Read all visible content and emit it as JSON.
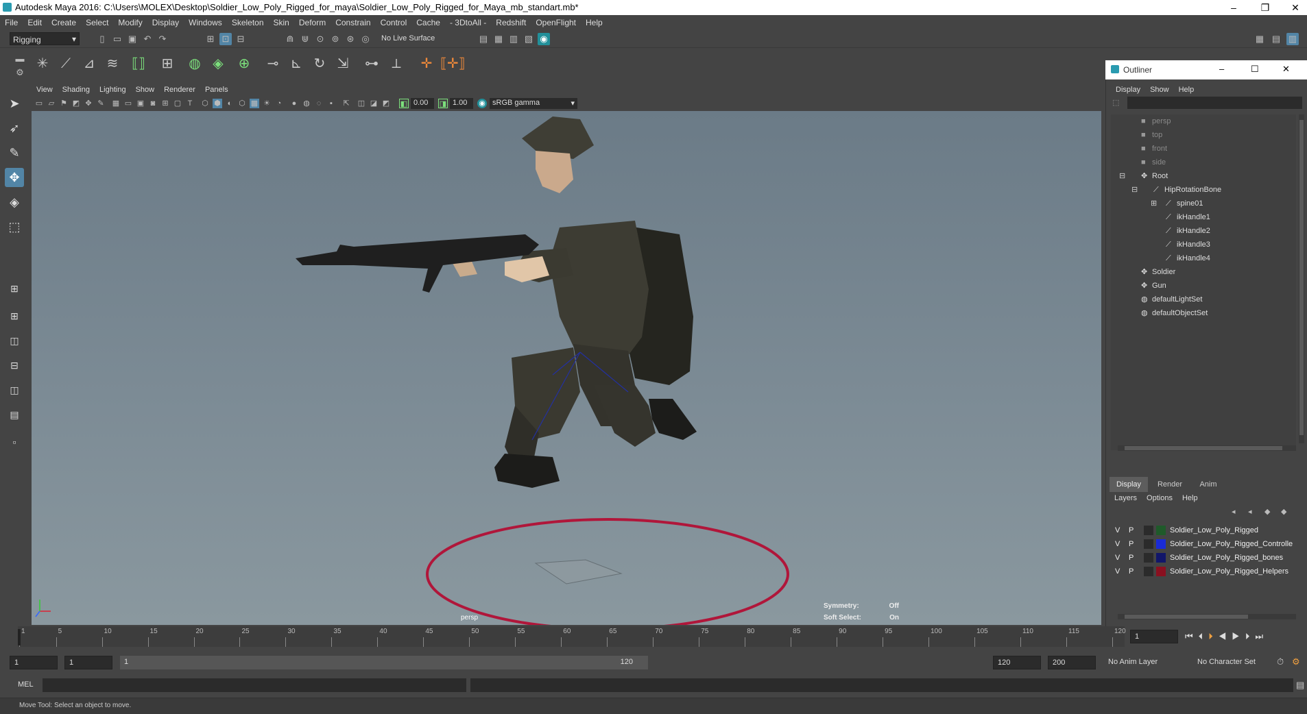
{
  "window": {
    "title": "Autodesk Maya 2016: C:\\Users\\MOLEX\\Desktop\\Soldier_Low_Poly_Rigged_for_maya\\Soldier_Low_Poly_Rigged_for_Maya_mb_standart.mb*",
    "controls": [
      "–",
      "❐",
      "✕"
    ]
  },
  "menubar": [
    "File",
    "Edit",
    "Create",
    "Select",
    "Modify",
    "Display",
    "Windows",
    "Skeleton",
    "Skin",
    "Deform",
    "Constrain",
    "Control",
    "Cache",
    "- 3DtoAll -",
    "Redshift",
    "OpenFlight",
    "Help"
  ],
  "toolbar": {
    "mode": "Rigging",
    "live_surface": "No Live Surface"
  },
  "viewport": {
    "menu": [
      "View",
      "Shading",
      "Lighting",
      "Show",
      "Renderer",
      "Panels"
    ],
    "near_value": "0.00",
    "far_value": "1.00",
    "color_space": "sRGB gamma",
    "camera_label": "persp",
    "hud": [
      {
        "label": "Symmetry:",
        "value": "Off"
      },
      {
        "label": "Soft Select:",
        "value": "On"
      }
    ]
  },
  "outliner": {
    "title": "Outliner",
    "menu": [
      "Display",
      "Show",
      "Help"
    ],
    "items": [
      {
        "label": "persp",
        "dim": true
      },
      {
        "label": "top",
        "dim": true
      },
      {
        "label": "front",
        "dim": true
      },
      {
        "label": "side",
        "dim": true
      },
      {
        "label": "Root"
      },
      {
        "label": "HipRotationBone"
      },
      {
        "label": "spine01"
      },
      {
        "label": "ikHandle1"
      },
      {
        "label": "ikHandle2"
      },
      {
        "label": "ikHandle3"
      },
      {
        "label": "ikHandle4"
      },
      {
        "label": "Soldier"
      },
      {
        "label": "Gun"
      },
      {
        "label": "defaultLightSet"
      },
      {
        "label": "defaultObjectSet"
      }
    ]
  },
  "layers": {
    "tabs": [
      "Display",
      "Render",
      "Anim"
    ],
    "menu": [
      "Layers",
      "Options",
      "Help"
    ],
    "rows": [
      {
        "v": "V",
        "p": "P",
        "name": "Soldier_Low_Poly_Rigged",
        "color": "#1f5a2a"
      },
      {
        "v": "V",
        "p": "P",
        "name": "Soldier_Low_Poly_Rigged_Controlle",
        "color": "#1a2bd6"
      },
      {
        "v": "V",
        "p": "P",
        "name": "Soldier_Low_Poly_Rigged_bones",
        "color": "#11166a"
      },
      {
        "v": "V",
        "p": "P",
        "name": "Soldier_Low_Poly_Rigged_Helpers",
        "color": "#8a1020"
      }
    ]
  },
  "timeline": {
    "ticks": [
      "1",
      "5",
      "10",
      "15",
      "20",
      "25",
      "30",
      "35",
      "40",
      "45",
      "50",
      "55",
      "60",
      "65",
      "70",
      "75",
      "80",
      "85",
      "90",
      "95",
      "100",
      "105",
      "110",
      "115",
      "120"
    ],
    "current_frame": "1"
  },
  "range": {
    "start": "1",
    "playback_start": "1",
    "slider_start": "1",
    "slider_end": "120",
    "playback_end": "120",
    "end": "200",
    "anim_layer": "No Anim Layer",
    "character_set": "No Character Set"
  },
  "command": {
    "lang": "MEL"
  },
  "help_line": "Move Tool: Select an object to move.",
  "colors": {
    "accent": "#5285a6",
    "helper_ring": "#b0163a"
  }
}
